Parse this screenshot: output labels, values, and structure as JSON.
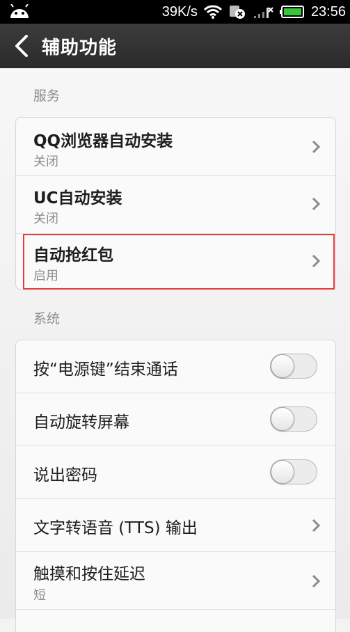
{
  "status_bar": {
    "speed": "39K/s",
    "time": "23:56",
    "icons": [
      "android-icon",
      "wifi-icon",
      "notification-icon",
      "signal-icon",
      "battery-icon"
    ]
  },
  "action_bar": {
    "back_icon": "chevron-left-icon",
    "title": "辅助功能"
  },
  "sections": {
    "services": {
      "label": "服务",
      "items": [
        {
          "title": "QQ浏览器自动安装",
          "subtitle": "关闭"
        },
        {
          "title": "UC自动安装",
          "subtitle": "关闭"
        },
        {
          "title": "自动抢红包",
          "subtitle": "启用"
        }
      ]
    },
    "system": {
      "label": "系统",
      "items": [
        {
          "title": "按“电源键”结束通话",
          "toggle": false
        },
        {
          "title": "自动旋转屏幕",
          "toggle": false
        },
        {
          "title": "说出密码",
          "toggle": false
        },
        {
          "title": "文字转语音 (TTS) 输出"
        },
        {
          "title": "触摸和按住延迟",
          "subtitle": "短"
        }
      ]
    }
  },
  "colors": {
    "highlight": "#e53b3b",
    "action_bar": "#333333",
    "status_bar": "#000000",
    "battery": "#37c837"
  }
}
